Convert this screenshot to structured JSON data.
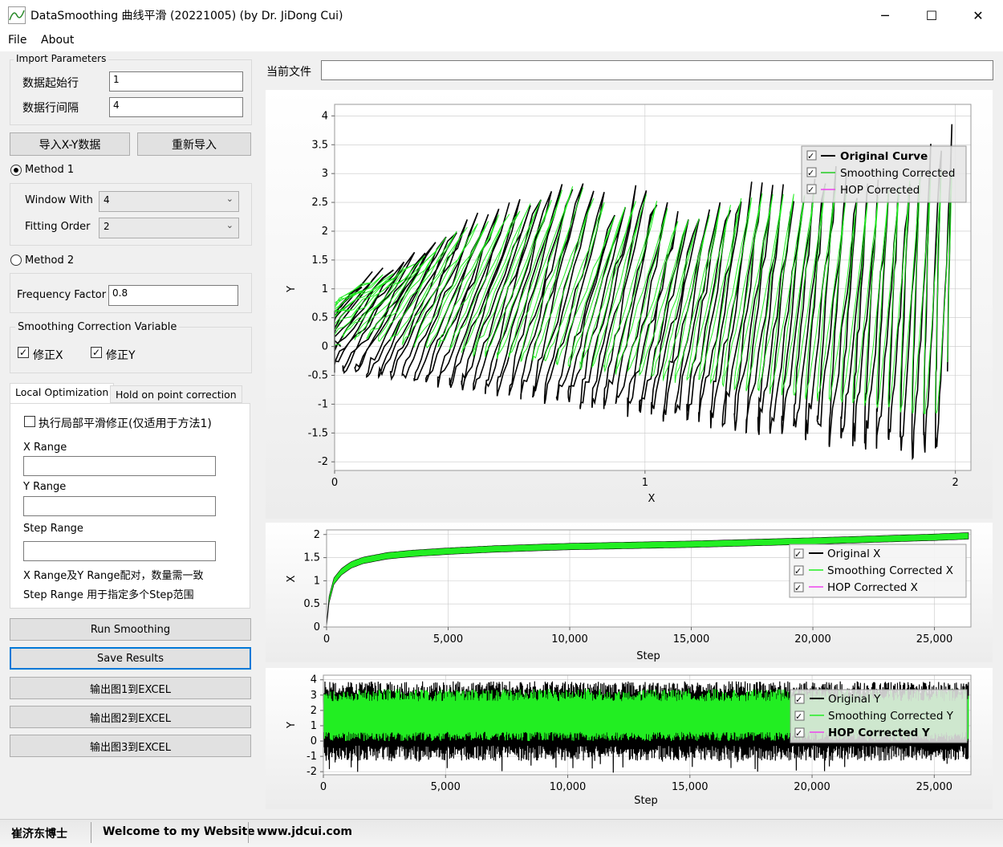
{
  "window": {
    "title": "DataSmoothing 曲线平滑 (20221005) (by Dr. JiDong Cui)",
    "minimize": "─",
    "maximize": "☐",
    "close": "✕"
  },
  "menu": [
    "File",
    "About"
  ],
  "import": {
    "group_label": "Import Parameters",
    "start_row_label": "数据起始行",
    "start_row_value": "1",
    "row_interval_label": "数据行间隔",
    "row_interval_value": "4",
    "import_btn": "导入X-Y数据",
    "reimport_btn": "重新导入"
  },
  "method1": {
    "label": "Method 1",
    "selected": true,
    "window_with_label": "Window With",
    "window_with_value": "4",
    "fitting_order_label": "Fitting Order",
    "fitting_order_value": "2"
  },
  "method2": {
    "label": "Method 2",
    "selected": false,
    "freq_label": "Frequency Factor",
    "freq_value": "0.8"
  },
  "correction": {
    "group_label": "Smoothing Correction Variable",
    "fix_x": "修正X",
    "fix_y": "修正Y"
  },
  "tabs": [
    "Local Optimization",
    "Hold on point correction"
  ],
  "local_opt": {
    "checkbox_label": "执行局部平滑修正(仅适用于方法1)",
    "x_range_label": "X Range",
    "x_range_value": "",
    "y_range_label": "Y Range",
    "y_range_value": "",
    "step_range_label": "Step Range",
    "step_range_value": "",
    "note1": "X Range及Y Range配对，数量需一致",
    "note2": "Step Range 用于指定多个Step范围"
  },
  "actions": {
    "run": "Run Smoothing",
    "save": "Save Results",
    "export1": "输出图1到EXCEL",
    "export2": "输出图2到EXCEL",
    "export3": "输出图3到EXCEL"
  },
  "current_file": {
    "label": "当前文件",
    "value": ""
  },
  "colors": {
    "original": "#000000",
    "smoothing": "#22ee22",
    "hop": "#ee44ee",
    "grid": "#c8c8c8",
    "focus": "#0078d7"
  },
  "chart_data": [
    {
      "type": "line",
      "xlabel": "X",
      "ylabel": "Y",
      "xlim": [
        0,
        2.05
      ],
      "ylim": [
        -2.15,
        4.2
      ],
      "x_ticks": [
        "0",
        "1",
        "2"
      ],
      "y_ticks": [
        "4",
        "3.5",
        "3",
        "2.5",
        "2",
        "1.5",
        "1",
        "0.5",
        "0",
        "-0.5",
        "-1",
        "-1.5",
        "-2"
      ],
      "legend": [
        "Original Curve",
        "Smoothing Corrected",
        "HOP Corrected"
      ],
      "legend_placement": "top-right",
      "grid": true,
      "series": [
        {
          "name": "Original Curve",
          "x": [
            0,
            0.04,
            0.1,
            0.2,
            0.3,
            0.4,
            0.5,
            0.62,
            0.7,
            0.8,
            0.9,
            1.0,
            1.1,
            1.2,
            1.3,
            1.4,
            1.5,
            1.6,
            1.7,
            1.8,
            1.9,
            2.0
          ],
          "y": [
            -0.5,
            0.6,
            1.2,
            1.4,
            1.7,
            2.1,
            2.3,
            2.5,
            2.7,
            2.9,
            2.4,
            2.8,
            2.3,
            2.4,
            2.6,
            2.8,
            2.7,
            3.0,
            2.6,
            2.8,
            3.2,
            3.9
          ]
        },
        {
          "name": "Smoothing Corrected",
          "x": [
            0,
            0.04,
            0.1,
            0.2,
            0.3,
            0.4,
            0.5,
            0.62,
            0.7,
            0.8,
            0.9,
            1.0,
            1.1,
            1.2,
            1.3,
            1.4,
            1.5,
            1.6,
            1.7,
            1.8,
            1.9,
            2.0
          ],
          "y": [
            -0.5,
            0.5,
            1.1,
            1.3,
            1.6,
            2.0,
            2.2,
            2.45,
            2.6,
            2.8,
            2.3,
            2.7,
            2.2,
            2.3,
            2.5,
            2.7,
            2.6,
            2.9,
            2.5,
            2.7,
            3.0,
            3.1
          ]
        }
      ]
    },
    {
      "type": "line",
      "xlabel": "Step",
      "ylabel": "X",
      "xlim": [
        0,
        26500
      ],
      "ylim": [
        0,
        2.1
      ],
      "x_ticks": [
        "0",
        "5,000",
        "10,000",
        "15,000",
        "20,000",
        "25,000"
      ],
      "y_ticks": [
        "2",
        "1.5",
        "1",
        "0.5",
        "0"
      ],
      "legend": [
        "Original X",
        "Smoothing Corrected X",
        "HOP Corrected X"
      ],
      "legend_placement": "top-right",
      "grid": true,
      "series": [
        {
          "name": "Smoothing Corrected X",
          "x": [
            0,
            100,
            300,
            600,
            1000,
            1500,
            2500,
            3500,
            5000,
            7000,
            10000,
            15000,
            20000,
            25000,
            26400
          ],
          "y": [
            0,
            0.6,
            1.0,
            1.2,
            1.35,
            1.45,
            1.55,
            1.6,
            1.65,
            1.7,
            1.75,
            1.8,
            1.87,
            1.95,
            1.98
          ]
        }
      ]
    },
    {
      "type": "line",
      "xlabel": "Step",
      "ylabel": "Y",
      "xlim": [
        0,
        26500
      ],
      "ylim": [
        -2.2,
        4.3
      ],
      "x_ticks": [
        "0",
        "5,000",
        "10,000",
        "15,000",
        "20,000",
        "25,000"
      ],
      "y_ticks": [
        "4",
        "3",
        "2",
        "1",
        "0",
        "-1",
        "-2"
      ],
      "legend": [
        "Original Y",
        "Smoothing Corrected Y",
        "HOP Corrected Y"
      ],
      "legend_placement": "top-right",
      "grid": true
    }
  ]
}
